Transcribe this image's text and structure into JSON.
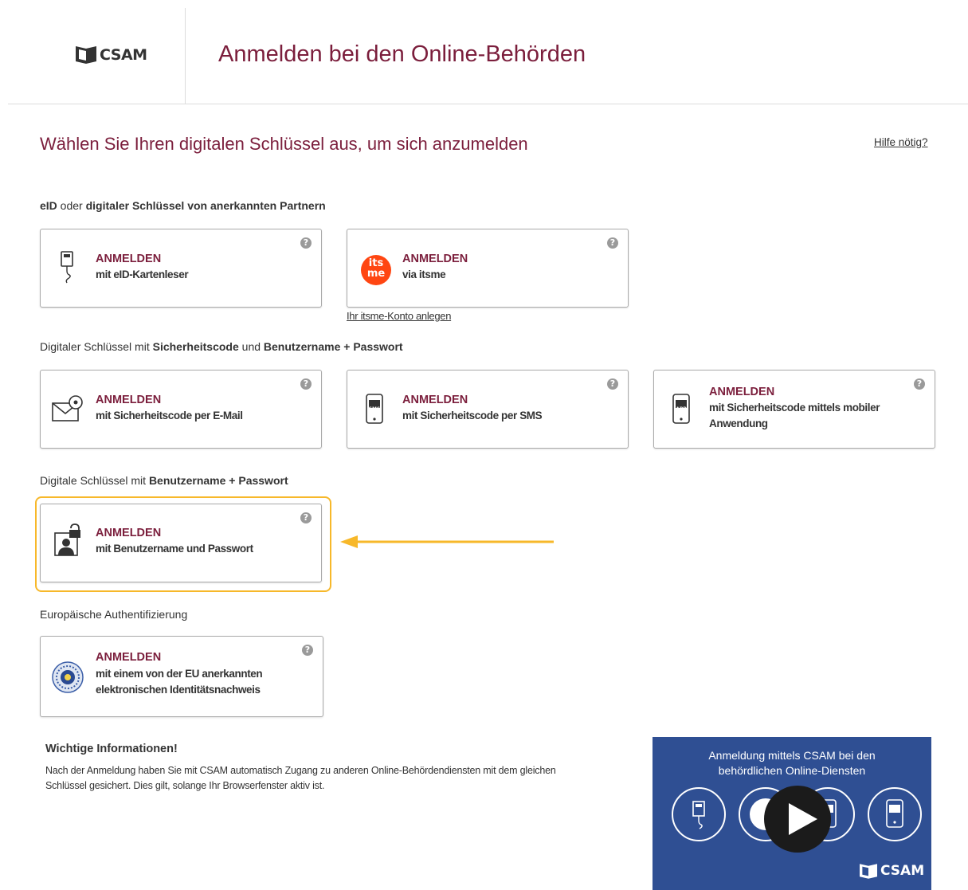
{
  "header": {
    "logo_text": "CSAM",
    "title": "Anmelden bei den Online-Behörden"
  },
  "subtitle": "Wählen Sie Ihren digitalen Schlüssel aus, um sich anzumelden",
  "help_link": "Hilfe nötig?",
  "sections": {
    "eid": {
      "p1": "eID",
      "p2": " oder ",
      "p3": "digitaler Schlüssel von anerkannten Partnern"
    },
    "security_code": {
      "p1": "Digitaler Schlüssel mit ",
      "p2": "Sicherheitscode",
      "p3": " und ",
      "p4": "Benutzername + Passwort"
    },
    "username": {
      "p1": "Digitale Schlüssel mit ",
      "p2": "Benutzername + Passwort"
    },
    "european": {
      "p1": "Europäische Authentifizierung"
    }
  },
  "cards": {
    "eid_reader": {
      "title": "ANMELDEN",
      "desc": "mit eID-Kartenleser",
      "icon": "card-reader-icon"
    },
    "itsme": {
      "title": "ANMELDEN",
      "desc": "via itsme",
      "icon": "itsme-logo",
      "icon_text_top": "its",
      "icon_text_bottom": "me",
      "icon_color": "#ff4612"
    },
    "email": {
      "title": "ANMELDEN",
      "desc": "mit Sicherheitscode per E-Mail",
      "icon": "email-code-icon"
    },
    "sms": {
      "title": "ANMELDEN",
      "desc": "mit Sicherheitscode per SMS",
      "icon": "sms-phone-icon",
      "icon_label": "SMS"
    },
    "app": {
      "title": "ANMELDEN",
      "desc": "mit Sicherheitscode mittels mobiler Anwendung",
      "icon": "app-phone-icon",
      "icon_label": "APP"
    },
    "password": {
      "title": "ANMELDEN",
      "desc": "mit Benutzername und Passwort",
      "icon": "user-lock-icon"
    },
    "eu": {
      "title": "ANMELDEN",
      "desc": "mit einem von der EU anerkannten elektronischen Identitätsnachweis",
      "icon": "eu-seal-icon"
    }
  },
  "help_icon_glyph": "?",
  "itsme_account_link": "Ihr itsme-Konto anlegen",
  "info": {
    "title": "Wichtige Informationen!",
    "text": "Nach der Anmeldung haben Sie mit CSAM automatisch Zugang zu anderen Online-Behördendiensten mit dem gleichen Schlüssel gesichert. Dies gilt, solange Ihr Browserfenster aktiv ist."
  },
  "video": {
    "title_line1": "Anmeldung mittels CSAM bei den",
    "title_line2": "behördlichen Online-Diensten",
    "logo_text": "CSAM",
    "background": "#2f4f93"
  },
  "colors": {
    "accent": "#7b1e3c",
    "highlight": "#f7b82a"
  }
}
